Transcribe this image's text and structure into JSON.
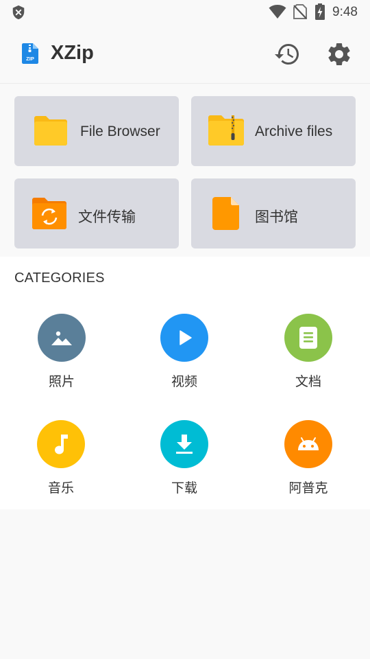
{
  "status_bar": {
    "time": "9:48"
  },
  "app_bar": {
    "title": "XZip",
    "logo_text": "ZIP"
  },
  "tiles": [
    {
      "label": "File Browser",
      "icon": "folder-icon",
      "color": "#FFCA28"
    },
    {
      "label": "Archive files",
      "icon": "zip-folder-icon",
      "color": "#FFCA28"
    },
    {
      "label": "文件传输",
      "icon": "sync-folder-icon",
      "color": "#FF8F00"
    },
    {
      "label": "图书馆",
      "icon": "document-icon",
      "color": "#FF9800"
    }
  ],
  "categories": {
    "heading": "CATEGORIES",
    "items": [
      {
        "label": "照片",
        "icon": "image-icon",
        "color": "#5A7F99"
      },
      {
        "label": "视频",
        "icon": "play-icon",
        "color": "#2196F3"
      },
      {
        "label": "文档",
        "icon": "document-icon",
        "color": "#8BC34A"
      },
      {
        "label": "音乐",
        "icon": "music-note-icon",
        "color": "#FFC107"
      },
      {
        "label": "下载",
        "icon": "download-icon",
        "color": "#00BCD4"
      },
      {
        "label": "阿普克",
        "icon": "android-icon",
        "color": "#FF8A00"
      }
    ]
  }
}
